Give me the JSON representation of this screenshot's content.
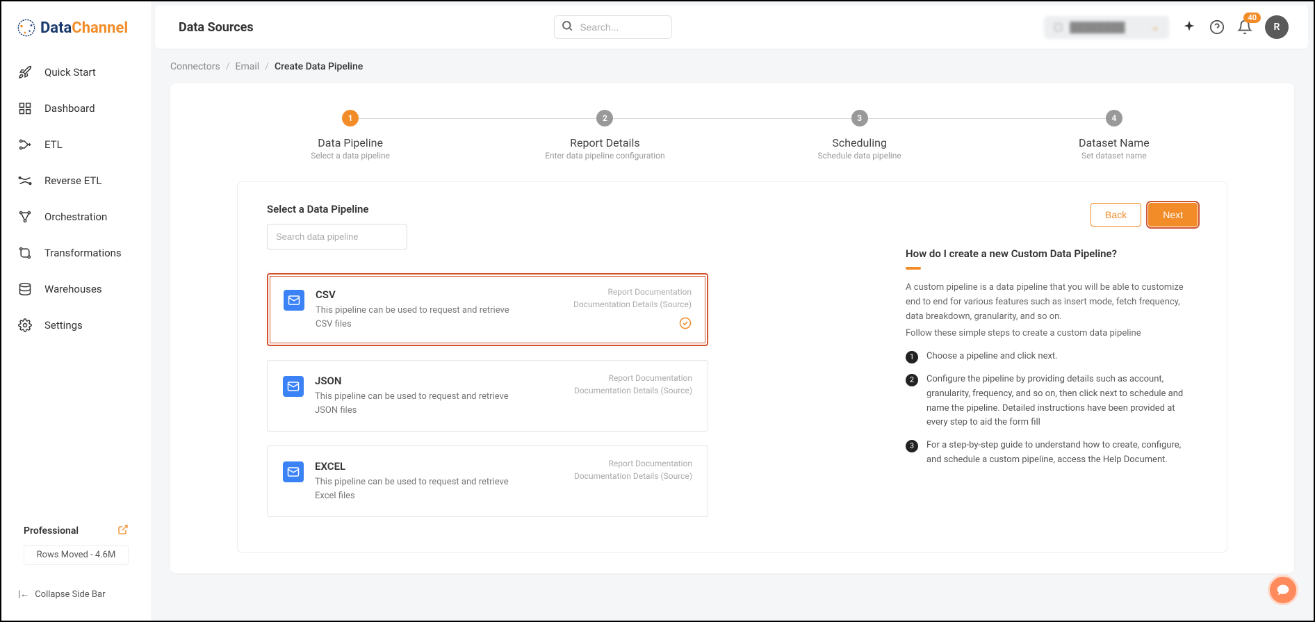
{
  "brand": {
    "name_a": "Data",
    "name_b": "Channel"
  },
  "sidebar": {
    "items": [
      {
        "label": "Quick Start"
      },
      {
        "label": "Dashboard"
      },
      {
        "label": "ETL"
      },
      {
        "label": "Reverse ETL"
      },
      {
        "label": "Orchestration"
      },
      {
        "label": "Transformations"
      },
      {
        "label": "Warehouses"
      },
      {
        "label": "Settings"
      }
    ],
    "plan": {
      "name": "Professional",
      "rows": "Rows Moved - 4.6M"
    },
    "collapse": "Collapse Side Bar"
  },
  "topbar": {
    "title": "Data Sources",
    "search_placeholder": "Search...",
    "notification_count": "40",
    "avatar_initial": "R"
  },
  "breadcrumb": {
    "a": "Connectors",
    "b": "Email",
    "c": "Create Data Pipeline"
  },
  "steps": [
    {
      "num": "1",
      "title": "Data Pipeline",
      "sub": "Select a data pipeline"
    },
    {
      "num": "2",
      "title": "Report Details",
      "sub": "Enter data pipeline configuration"
    },
    {
      "num": "3",
      "title": "Scheduling",
      "sub": "Schedule data pipeline"
    },
    {
      "num": "4",
      "title": "Dataset Name",
      "sub": "Set dataset name"
    }
  ],
  "select": {
    "title": "Select a Data Pipeline",
    "search_placeholder": "Search data pipeline",
    "back": "Back",
    "next": "Next"
  },
  "pipelines": [
    {
      "title": "CSV",
      "desc": "This pipeline can be used to request and retrieve CSV files",
      "link1": "Report Documentation",
      "link2": "Documentation Details (Source)"
    },
    {
      "title": "JSON",
      "desc": "This pipeline can be used to request and retrieve JSON files",
      "link1": "Report Documentation",
      "link2": "Documentation Details (Source)"
    },
    {
      "title": "EXCEL",
      "desc": "This pipeline can be used to request and retrieve Excel files",
      "link1": "Report Documentation",
      "link2": "Documentation Details (Source)"
    }
  ],
  "help": {
    "title": "How do I create a new Custom Data Pipeline?",
    "p1": "A custom pipeline is a data pipeline that you will be able to customize end to end for various features such as insert mode, fetch frequency, data breakdown, granularity, and so on.",
    "p2": "Follow these simple steps to create a custom data pipeline",
    "steps": [
      "Choose a pipeline and click next.",
      "Configure the pipeline by providing details such as account, granularity, frequency, and so on, then click next to schedule and name the pipeline. Detailed instructions have been provided at every step to aid the form fill",
      "For a step-by-step guide to understand how to create, configure, and schedule a custom pipeline, access the Help Document."
    ]
  }
}
